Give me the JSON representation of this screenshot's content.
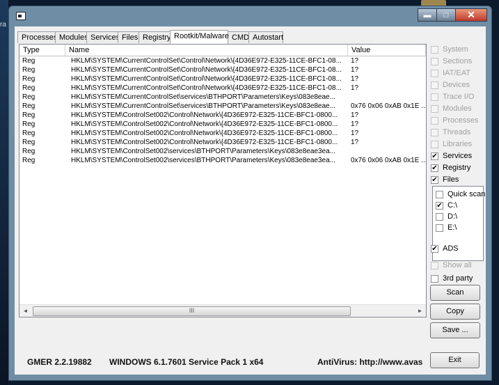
{
  "desktop": {
    "side_text": "ra"
  },
  "window": {
    "title_icon": "gmer-window-icon"
  },
  "caption_buttons": {
    "minimize": "▬",
    "maximize": "□",
    "close": "✕"
  },
  "tabs": [
    {
      "label": "Processes",
      "active": false
    },
    {
      "label": "Modules",
      "active": false
    },
    {
      "label": "Services",
      "active": false
    },
    {
      "label": "Files",
      "active": false
    },
    {
      "label": "Registry",
      "active": false
    },
    {
      "label": "Rootkit/Malware",
      "active": true
    },
    {
      "label": "CMD",
      "active": false
    },
    {
      "label": "Autostart",
      "active": false
    }
  ],
  "table": {
    "columns": [
      "Type",
      "Name",
      "Value"
    ],
    "rows": [
      [
        "Reg",
        "HKLM\\SYSTEM\\CurrentControlSet\\Control\\Network\\{4D36E972-E325-11CE-BFC1-08...",
        "1?"
      ],
      [
        "Reg",
        "HKLM\\SYSTEM\\CurrentControlSet\\Control\\Network\\{4D36E972-E325-11CE-BFC1-08...",
        "1?"
      ],
      [
        "Reg",
        "HKLM\\SYSTEM\\CurrentControlSet\\Control\\Network\\{4D36E972-E325-11CE-BFC1-08...",
        "1?"
      ],
      [
        "Reg",
        "HKLM\\SYSTEM\\CurrentControlSet\\Control\\Network\\{4D36E972-E325-11CE-BFC1-08...",
        "1?"
      ],
      [
        "Reg",
        "HKLM\\SYSTEM\\CurrentControlSet\\services\\BTHPORT\\Parameters\\Keys\\083e8eae...",
        ""
      ],
      [
        "Reg",
        "HKLM\\SYSTEM\\CurrentControlSet\\services\\BTHPORT\\Parameters\\Keys\\083e8eae...",
        "0x76 0x06 0xAB 0x1E ..."
      ],
      [
        "Reg",
        "HKLM\\SYSTEM\\ControlSet002\\Control\\Network\\{4D36E972-E325-11CE-BFC1-0800...",
        "1?"
      ],
      [
        "Reg",
        "HKLM\\SYSTEM\\ControlSet002\\Control\\Network\\{4D36E972-E325-11CE-BFC1-0800...",
        "1?"
      ],
      [
        "Reg",
        "HKLM\\SYSTEM\\ControlSet002\\Control\\Network\\{4D36E972-E325-11CE-BFC1-0800...",
        "1?"
      ],
      [
        "Reg",
        "HKLM\\SYSTEM\\ControlSet002\\Control\\Network\\{4D36E972-E325-11CE-BFC1-0800...",
        "1?"
      ],
      [
        "Reg",
        "HKLM\\SYSTEM\\ControlSet002\\services\\BTHPORT\\Parameters\\Keys\\083e8eae3ea...",
        ""
      ],
      [
        "Reg",
        "HKLM\\SYSTEM\\ControlSet002\\services\\BTHPORT\\Parameters\\Keys\\083e8eae3ea...",
        "0x76 0x06 0xAB 0x1E ..."
      ]
    ]
  },
  "scrollbar": {
    "left_arrow": "◄",
    "right_arrow": "►",
    "grip": "III"
  },
  "options": [
    {
      "label": "System",
      "checked": false,
      "enabled": false
    },
    {
      "label": "Sections",
      "checked": false,
      "enabled": false
    },
    {
      "label": "IAT/EAT",
      "checked": false,
      "enabled": false
    },
    {
      "label": "Devices",
      "checked": false,
      "enabled": false
    },
    {
      "label": "Trace I/O",
      "checked": false,
      "enabled": false
    },
    {
      "label": "Modules",
      "checked": false,
      "enabled": false
    },
    {
      "label": "Processes",
      "checked": false,
      "enabled": false
    },
    {
      "label": "Threads",
      "checked": false,
      "enabled": false
    },
    {
      "label": "Libraries",
      "checked": false,
      "enabled": false
    },
    {
      "label": "Services",
      "checked": true,
      "enabled": true
    },
    {
      "label": "Registry",
      "checked": true,
      "enabled": true
    },
    {
      "label": "Files",
      "checked": true,
      "enabled": true
    }
  ],
  "drives": [
    {
      "label": "Quick scan",
      "checked": false
    },
    {
      "label": "C:\\",
      "checked": true
    },
    {
      "label": "D:\\",
      "checked": false
    },
    {
      "label": "E:\\",
      "checked": false
    }
  ],
  "extra_options": [
    {
      "label": "ADS",
      "checked": true,
      "enabled": true
    },
    {
      "label": "Show all",
      "checked": false,
      "enabled": false
    },
    {
      "label": "3rd party",
      "checked": false,
      "enabled": true
    }
  ],
  "buttons": {
    "scan": "Scan",
    "copy": "Copy",
    "save": "Save ...",
    "exit": "Exit"
  },
  "status": {
    "version": "GMER 2.2.19882",
    "os": "WINDOWS 6.1.7601 Service Pack 1 x64",
    "antivirus": "AntiVirus: http://www.avas"
  },
  "colors": {
    "window_frame": "#6f8ea6",
    "client_bg": "#f0f0f0",
    "close_button": "#c0392b"
  }
}
